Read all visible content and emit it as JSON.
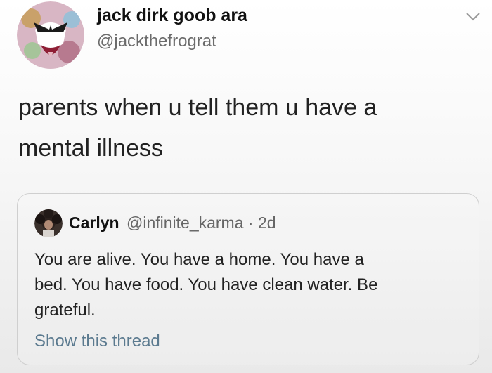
{
  "tweet": {
    "author": {
      "display_name": "jack dirk goob ara",
      "handle": "@jackthefrograt",
      "avatar_icon": "cartoon-avatar-icon"
    },
    "menu_icon": "chevron-down-icon",
    "text_line1": "parents when u tell them u have a",
    "text_line2": "mental illness"
  },
  "quoted_tweet": {
    "author": {
      "display_name": "Carlyn",
      "handle": "@infinite_karma",
      "separator": "·",
      "time": "2d",
      "avatar_icon": "profile-photo-icon"
    },
    "text_line1": "You are alive. You have a home. You have a",
    "text_line2": "bed. You have food. You have clean water. Be",
    "text_line3": "grateful.",
    "show_thread_label": "Show this thread"
  },
  "colors": {
    "handle_gray": "#6b6b6b",
    "link_blue_gray": "#5b7a8f",
    "border": "#cfcfcf"
  }
}
